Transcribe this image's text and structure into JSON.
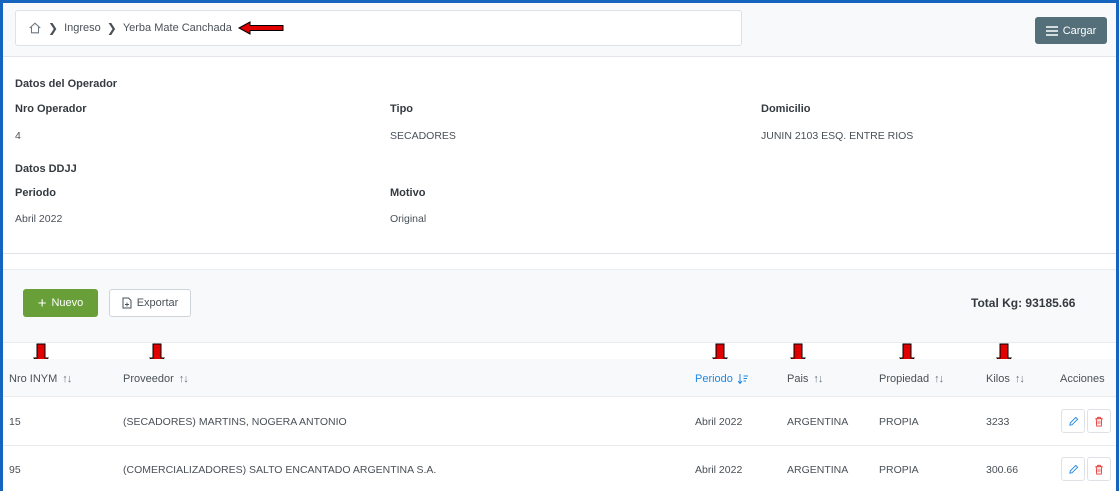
{
  "breadcrumb": {
    "items": [
      "Ingreso",
      "Yerba Mate Canchada"
    ]
  },
  "actions": {
    "cargar_label": "Cargar"
  },
  "operador": {
    "section_title": "Datos del Operador",
    "nro_label": "Nro Operador",
    "nro_value": "4",
    "tipo_label": "Tipo",
    "tipo_value": "SECADORES",
    "domicilio_label": "Domicilio",
    "domicilio_value": "JUNIN 2103 ESQ. ENTRE RIOS"
  },
  "ddjj": {
    "section_title": "Datos DDJJ",
    "periodo_label": "Periodo",
    "periodo_value": "Abril 2022",
    "motivo_label": "Motivo",
    "motivo_value": "Original"
  },
  "toolbar": {
    "nuevo_label": "Nuevo",
    "exportar_label": "Exportar",
    "total_label": "Total Kg: 93185.66"
  },
  "table": {
    "columns": [
      "Nro INYM",
      "Proveedor",
      "Periodo",
      "Pais",
      "Propiedad",
      "Kilos",
      "Acciones"
    ],
    "rows": [
      [
        "15",
        "(SECADORES) MARTINS, NOGERA ANTONIO",
        "Abril 2022",
        "ARGENTINA",
        "PROPIA",
        "3233"
      ],
      [
        "95",
        "(COMERCIALIZADORES) SALTO ENCANTADO ARGENTINA S.A.",
        "Abril 2022",
        "ARGENTINA",
        "PROPIA",
        "300.66"
      ]
    ]
  },
  "colors": {
    "accent": "#1e88e5",
    "success": "#689f38",
    "secondary": "#546e7a",
    "danger": "#e53935",
    "annotation": "#e00000"
  },
  "icons": [
    "home-icon",
    "chevron-right-icon",
    "menu-icon",
    "plus-icon",
    "file-export-icon",
    "sort-icon",
    "sort-desc-icon",
    "pencil-icon",
    "trash-icon",
    "red-arrow-annotation"
  ]
}
